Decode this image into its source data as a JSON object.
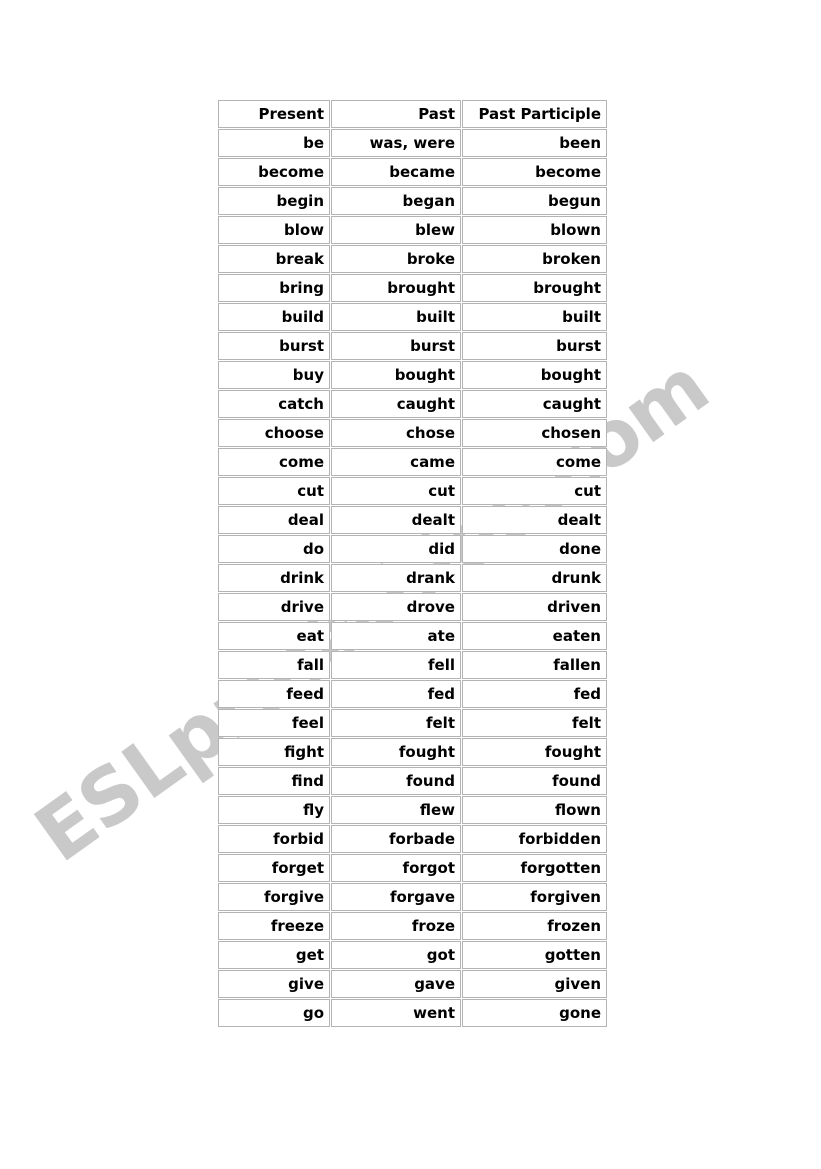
{
  "page": {
    "background_color": "#ffffff",
    "watermark": {
      "text": "ESLprintables.com",
      "color": "#c9c9c9"
    }
  },
  "table": {
    "headers": [
      "Present",
      "Past",
      "Past Participle"
    ],
    "rows": [
      [
        "be",
        "was, were",
        "been"
      ],
      [
        "become",
        "became",
        "become"
      ],
      [
        "begin",
        "began",
        "begun"
      ],
      [
        "blow",
        "blew",
        "blown"
      ],
      [
        "break",
        "broke",
        "broken"
      ],
      [
        "bring",
        "brought",
        "brought"
      ],
      [
        "build",
        "built",
        "built"
      ],
      [
        "burst",
        "burst",
        "burst"
      ],
      [
        "buy",
        "bought",
        "bought"
      ],
      [
        "catch",
        "caught",
        "caught"
      ],
      [
        "choose",
        "chose",
        "chosen"
      ],
      [
        "come",
        "came",
        "come"
      ],
      [
        "cut",
        "cut",
        "cut"
      ],
      [
        "deal",
        "dealt",
        "dealt"
      ],
      [
        "do",
        "did",
        "done"
      ],
      [
        "drink",
        "drank",
        "drunk"
      ],
      [
        "drive",
        "drove",
        "driven"
      ],
      [
        "eat",
        "ate",
        "eaten"
      ],
      [
        "fall",
        "fell",
        "fallen"
      ],
      [
        "feed",
        "fed",
        "fed"
      ],
      [
        "feel",
        "felt",
        "felt"
      ],
      [
        "fight",
        "fought",
        "fought"
      ],
      [
        "find",
        "found",
        "found"
      ],
      [
        "fly",
        "flew",
        "flown"
      ],
      [
        "forbid",
        "forbade",
        "forbidden"
      ],
      [
        "forget",
        "forgot",
        "forgotten"
      ],
      [
        "forgive",
        "forgave",
        "forgiven"
      ],
      [
        "freeze",
        "froze",
        "frozen"
      ],
      [
        "get",
        "got",
        "gotten"
      ],
      [
        "give",
        "gave",
        "given"
      ],
      [
        "go",
        "went",
        "gone"
      ]
    ]
  }
}
